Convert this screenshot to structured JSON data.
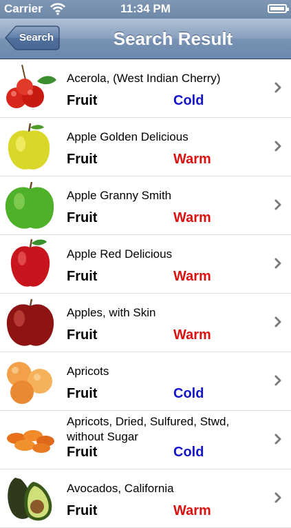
{
  "status_bar": {
    "carrier": "Carrier",
    "time": "11:34 PM"
  },
  "nav": {
    "back_label": "Search",
    "title": "Search Result"
  },
  "items": [
    {
      "name": "Acerola, (West Indian Cherry)",
      "category": "Fruit",
      "temperature": "Cold",
      "icon": "acerola-icon"
    },
    {
      "name": "Apple Golden Delicious",
      "category": "Fruit",
      "temperature": "Warm",
      "icon": "golden-apple-icon"
    },
    {
      "name": "Apple Granny Smith",
      "category": "Fruit",
      "temperature": "Warm",
      "icon": "green-apple-icon"
    },
    {
      "name": "Apple Red Delicious",
      "category": "Fruit",
      "temperature": "Warm",
      "icon": "red-apple-icon"
    },
    {
      "name": "Apples, with Skin",
      "category": "Fruit",
      "temperature": "Warm",
      "icon": "apple-icon"
    },
    {
      "name": "Apricots",
      "category": "Fruit",
      "temperature": "Cold",
      "icon": "apricot-icon"
    },
    {
      "name": "Apricots, Dried, Sulfured, Stwd, without Sugar",
      "category": "Fruit",
      "temperature": "Cold",
      "icon": "dried-apricot-icon"
    },
    {
      "name": "Avocados, California",
      "category": "Fruit",
      "temperature": "Warm",
      "icon": "avocado-icon"
    }
  ],
  "colors": {
    "cold": "#1414c8",
    "warm": "#dd1010",
    "nav_bar": "#7792b4"
  }
}
